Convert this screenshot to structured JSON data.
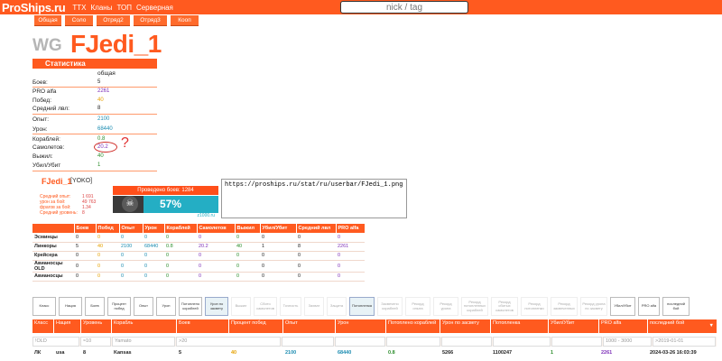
{
  "header": {
    "logo": "ProShips.ru",
    "nav": [
      "ТТХ",
      "Кланы",
      "ТОП",
      "Серверная"
    ],
    "search_placeholder": "nick / tag"
  },
  "tabs": [
    "Общая",
    "Соло",
    "Отряд2",
    "Отряд3",
    "Кооп"
  ],
  "player": {
    "server": "WG",
    "name": "FJedi_1"
  },
  "stats": {
    "title": "Статистика",
    "col_header": "общая",
    "rows": [
      {
        "label": "Боев:",
        "value": "5",
        "color": "#222"
      },
      {
        "label": "PRO alfa",
        "value": "2261",
        "color": "#7d2fb8"
      },
      {
        "label": "Побед:",
        "value": "40",
        "color": "#e6a100"
      },
      {
        "label": "Средний лвл:",
        "value": "8",
        "color": "#222"
      },
      {
        "label": "Опыт:",
        "value": "2100",
        "color": "#1a8bb0"
      },
      {
        "label": "Урон:",
        "value": "68440",
        "color": "#1a8bb0"
      },
      {
        "label": "Кораблей:",
        "value": "0.8",
        "color": "#2a8c2a"
      },
      {
        "label": "Самолетов:",
        "value": "20.2",
        "color": "#7d2fb8"
      },
      {
        "label": "Выжил:",
        "value": "40",
        "color": "#2a8c2a"
      },
      {
        "label": "Убил/Убит",
        "value": "1",
        "color": "#2a8c2a"
      }
    ]
  },
  "userbar": {
    "name": "FJedi_1",
    "tag": "[YOKO]",
    "lines": [
      {
        "label": "Средний опыт:",
        "value": "1 691"
      },
      {
        "label": "урон за бой:",
        "value": "49 763"
      },
      {
        "label": "фрагов за бой:",
        "value": "1.34"
      },
      {
        "label": "Средний уровень:",
        "value": "8"
      }
    ],
    "games": "Проведено боев: 1284",
    "winrate": "57% ПОБЕД",
    "site": "z1000.ru",
    "url": "https://proships.ru/stat/ru/userbar/FJedi_1.png"
  },
  "class_table": {
    "headers": [
      "",
      "Боев",
      "Побед",
      "Опыт",
      "Урон",
      "Кораблей",
      "Самолетов",
      "Выжил",
      "Убил/Убит",
      "Средний лвл",
      "PRO alfa"
    ],
    "rows": [
      [
        "Эсминцы",
        "0",
        "0",
        "0",
        "0",
        "0",
        "0",
        "0",
        "0",
        "0",
        "0"
      ],
      [
        "Линкоры",
        "5",
        "40",
        "2100",
        "68440",
        "0.8",
        "20.2",
        "40",
        "1",
        "8",
        "2261"
      ],
      [
        "Крейсера",
        "0",
        "0",
        "0",
        "0",
        "0",
        "0",
        "0",
        "0",
        "0",
        "0"
      ],
      [
        "Авианосцы OLD",
        "0",
        "0",
        "0",
        "0",
        "0",
        "0",
        "0",
        "0",
        "0",
        "0"
      ],
      [
        "Авианосцы",
        "0",
        "0",
        "0",
        "0",
        "0",
        "0",
        "0",
        "0",
        "0",
        "0"
      ]
    ]
  },
  "filters": [
    "Класс",
    "Нация",
    "Боев",
    "Процент побед",
    "Опыт",
    "Урон",
    "Потоплено кораблей",
    "Урон по засвету",
    "Выжил",
    "Сбито самолетов",
    "Точность",
    "Захват",
    "Защита",
    "Потопленка",
    "Засвечено кораблей",
    "Рекорд опыта",
    "Рекорд урона",
    "Рекорд потопленных кораблей",
    "Рекорд сбитых самолетов",
    "Рекорд потопленки",
    "Рекорд засвеченных",
    "Рекорд урона по засвету",
    "Убил/Убит",
    "PRO alfa",
    "последний бой"
  ],
  "ship_table": {
    "headers": [
      "Класс",
      "Нация",
      "Уровень",
      "Корабль",
      "Боев",
      "Процент побед",
      "Опыт",
      "Урон",
      "Потоплено кораблей",
      "Урон по засвету",
      "Потопленка",
      "Убил/Убит",
      "PRO alfa",
      "последний бой"
    ],
    "filter_row": [
      "!OLD",
      "",
      "≈10",
      "Yamato",
      ">20",
      "",
      "",
      "",
      "",
      "",
      "",
      "",
      "1000 - 3000",
      ">2019-01-01"
    ],
    "row": [
      "ЛК",
      "usa",
      "8",
      "Kansas",
      "5",
      "40",
      "2100",
      "68440",
      "0.8",
      "5266",
      "1100247",
      "1",
      "2261",
      "2024-03-26 16:03:39"
    ]
  }
}
